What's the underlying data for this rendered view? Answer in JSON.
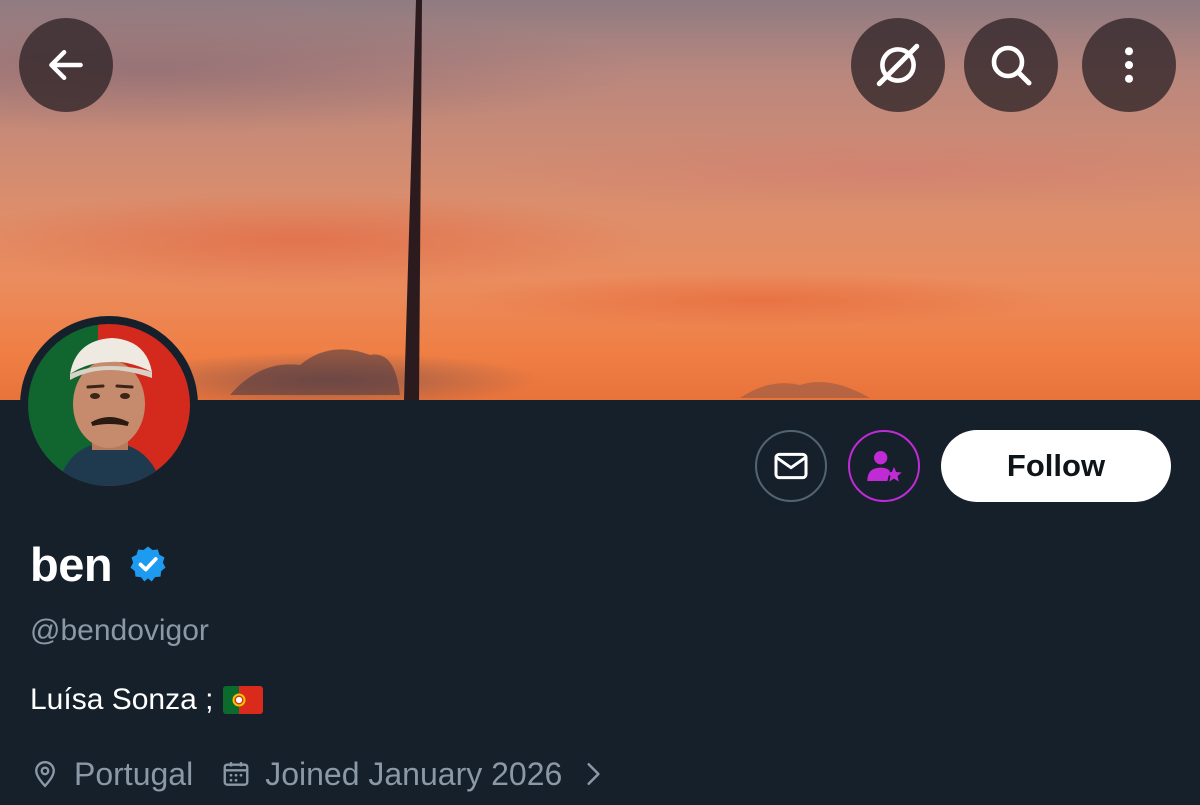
{
  "header": {
    "back_icon": "arrow-left-icon",
    "action_icons": [
      "grok-icon",
      "search-icon",
      "more-vertical-icon"
    ]
  },
  "profile": {
    "name": "ben",
    "verified": true,
    "handle": "@bendovigor",
    "bio": "Luísa Sonza ;",
    "bio_emoji": "flag-portugal",
    "location": "Portugal",
    "joined": "Joined January 2026"
  },
  "actions": {
    "message_icon": "mail-icon",
    "subscribe_icon": "person-star-icon",
    "follow_label": "Follow"
  },
  "colors": {
    "background": "#15202b",
    "secondary_text": "#8b98a5",
    "verified_blue": "#1d9bf0",
    "subscribe_accent": "#c02bd6"
  }
}
